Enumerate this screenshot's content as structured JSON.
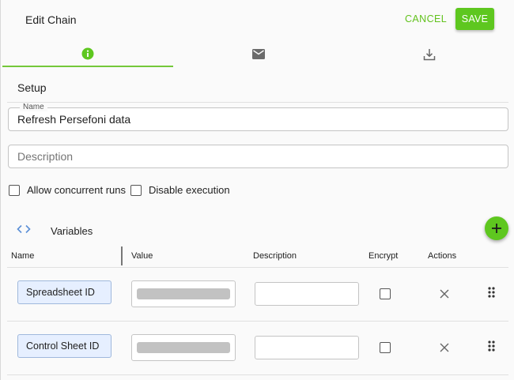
{
  "header": {
    "title": "Edit Chain",
    "cancel_label": "CANCEL",
    "save_label": "SAVE"
  },
  "tabs": [
    {
      "icon": "info-icon",
      "active": true
    },
    {
      "icon": "mail-icon",
      "active": false
    },
    {
      "icon": "download-icon",
      "active": false
    }
  ],
  "setup": {
    "section_title": "Setup",
    "name_label": "Name",
    "name_value": "Refresh Persefoni data",
    "description_placeholder": "Description",
    "allow_concurrent_label": "Allow concurrent runs",
    "disable_execution_label": "Disable execution"
  },
  "variables": {
    "title": "Variables",
    "header_icon": "code-icon",
    "add_icon": "plus-icon",
    "columns": [
      "Name",
      "Value",
      "Description",
      "Encrypt",
      "Actions"
    ],
    "rows": [
      {
        "name": "Spreadsheet ID"
      },
      {
        "name": "Control Sheet ID"
      }
    ]
  },
  "colors": {
    "accent": "#5ec71f",
    "chip_bg": "#e6efff",
    "chip_border": "#9fb8dc"
  }
}
